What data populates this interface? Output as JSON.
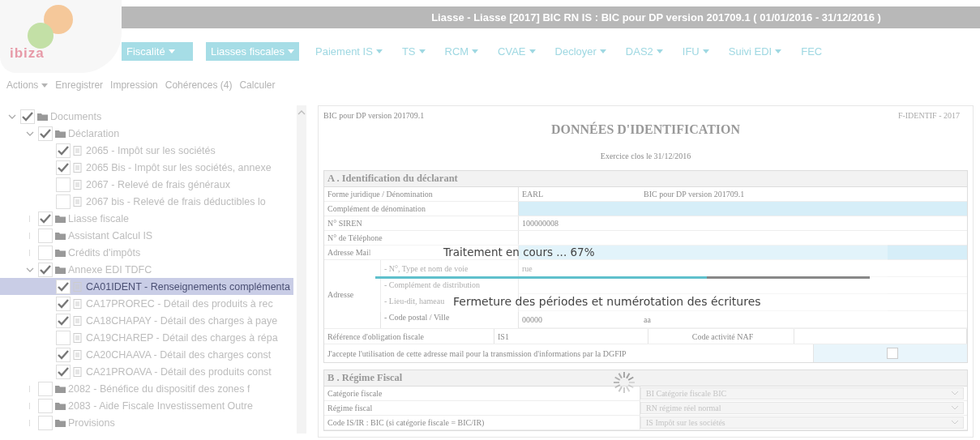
{
  "window": {
    "title": "Liasse - Liasse [2017] BIC RN IS : BIC pour DP version 201709.1 ( 01/01/2016 - 31/12/2016 )"
  },
  "logo": {
    "text": "ibiza"
  },
  "module": {
    "label": "Fiscalité"
  },
  "nav": [
    {
      "label": "Liasses fiscales",
      "selected": true,
      "menu": true
    },
    {
      "label": "Paiement IS",
      "selected": false,
      "menu": true
    },
    {
      "label": "TS",
      "selected": false,
      "menu": true
    },
    {
      "label": "RCM",
      "selected": false,
      "menu": true
    },
    {
      "label": "CVAE",
      "selected": false,
      "menu": true
    },
    {
      "label": "Decloyer",
      "selected": false,
      "menu": true
    },
    {
      "label": "DAS2",
      "selected": false,
      "menu": true
    },
    {
      "label": "IFU",
      "selected": false,
      "menu": true
    },
    {
      "label": "Suivi EDI",
      "selected": false,
      "menu": true
    },
    {
      "label": "FEC",
      "selected": false,
      "menu": false
    }
  ],
  "toolbar": [
    {
      "label": "Actions",
      "menu": true
    },
    {
      "label": "Enregistrer",
      "menu": false
    },
    {
      "label": "Impression",
      "menu": false
    },
    {
      "label": "Cohérences (4)",
      "menu": false
    },
    {
      "label": "Calculer",
      "menu": false
    }
  ],
  "tree": [
    {
      "label": "Documents",
      "kind": "folder",
      "checked": true,
      "expanded": true,
      "selected": false,
      "children": [
        {
          "label": "Déclaration",
          "kind": "folder",
          "checked": true,
          "expanded": true,
          "selected": false,
          "children": [
            {
              "label": "2065 - Impôt sur les sociétés",
              "kind": "doc",
              "checked": true,
              "selected": false
            },
            {
              "label": "2065 Bis - Impôt sur les sociétés, annexe",
              "kind": "doc",
              "checked": true,
              "selected": false
            },
            {
              "label": "2067 - Relevé de frais généraux",
              "kind": "doc",
              "checked": false,
              "selected": false
            },
            {
              "label": "2067 bis - Relevé de frais déductibles lo",
              "kind": "doc",
              "checked": false,
              "selected": false
            }
          ]
        },
        {
          "label": "Liasse fiscale",
          "kind": "folder",
          "checked": true,
          "expanded": false,
          "selected": false
        },
        {
          "label": "Assistant Calcul IS",
          "kind": "folder",
          "checked": false,
          "expanded": false,
          "selected": false
        },
        {
          "label": "Crédits d'impôts",
          "kind": "folder",
          "checked": false,
          "expanded": false,
          "selected": false
        },
        {
          "label": "Annexe EDI TDFC",
          "kind": "folder",
          "checked": true,
          "expanded": true,
          "selected": false,
          "children": [
            {
              "label": "CA01IDENT - Renseignements complémenta",
              "kind": "doc",
              "checked": true,
              "selected": true
            },
            {
              "label": "CA17PROREC - Détail des produits à rec",
              "kind": "doc",
              "checked": true,
              "selected": false
            },
            {
              "label": "CA18CHAPAY - Détail des charges à paye",
              "kind": "doc",
              "checked": true,
              "selected": false
            },
            {
              "label": "CA19CHAREP - Détail des charges à répa",
              "kind": "doc",
              "checked": false,
              "selected": false
            },
            {
              "label": "CA20CHAAVA - Détail des charges const",
              "kind": "doc",
              "checked": true,
              "selected": false
            },
            {
              "label": "CA21PROAVA - Détail des produits const",
              "kind": "doc",
              "checked": true,
              "selected": false
            }
          ]
        },
        {
          "label": "2082 - Bénéfice du dispositif des zones f",
          "kind": "folder",
          "checked": false,
          "expanded": false,
          "selected": false
        },
        {
          "label": "2083 - Aide Fiscale Investissement Outre",
          "kind": "folder",
          "checked": false,
          "expanded": false,
          "selected": false
        },
        {
          "label": "Provisions",
          "kind": "folder",
          "checked": false,
          "expanded": false,
          "selected": false
        }
      ]
    }
  ],
  "form": {
    "doc_ref": "BIC pour DP version 201709.1",
    "title": "DONNÉES D'IDENTIFICATION",
    "form_code": "F-IDENTIF - 2017",
    "subtitle": "Exercice clos le 31/12/2016",
    "sections": [
      {
        "title": "A . Identification du déclarant",
        "rows": [
          {
            "kind": "field",
            "label": "Forme juridique / Dénomination",
            "value": "EARL",
            "value_2": "BIC pour DP version 201709.1",
            "editable": false
          },
          {
            "kind": "field",
            "label": "Complément de dénomination",
            "editable": true
          },
          {
            "kind": "field",
            "label": "N° SIREN",
            "value": "100000008",
            "editable": false
          },
          {
            "kind": "field",
            "label": "N° de Téléphone",
            "editable": false
          },
          {
            "kind": "field",
            "label": "Adresse Mail",
            "editable": true
          },
          {
            "kind": "address",
            "label": "Adresse",
            "lines": [
              {
                "label": "- N°, Type et nom de voie",
                "value": "rue"
              },
              {
                "label": "- Complément de distribution"
              },
              {
                "label": "- Lieu-dit, hameau"
              },
              {
                "label": "- Code postal / Ville",
                "value": "00000",
                "value_2": "aa"
              }
            ]
          },
          {
            "kind": "pair",
            "label": "Référence d'obligation fiscale",
            "value": "IS1",
            "label_2": "Code activité NAF"
          },
          {
            "kind": "consent",
            "label": "J'accepte l'utilisation de cette adresse mail pour la transmission d'informations par la DGFIP",
            "checked": false
          }
        ]
      },
      {
        "title": "B . Régime Fiscal",
        "rows": [
          {
            "kind": "select",
            "label": "Catégorie fiscale",
            "value": "BI Catégorie fiscale BIC"
          },
          {
            "kind": "select",
            "label": "Régime fiscal",
            "value": "RN régime réel normal"
          },
          {
            "kind": "select",
            "label": "Code IS/IR : BIC (si catégorie fiscale = BIC/IR)",
            "value": "IS Impôt sur les sociétés"
          }
        ]
      }
    ]
  },
  "progress": {
    "status": "Traitement en cours ... 67%",
    "level": 0.67,
    "message": "Fermeture des périodes et numérotation des écritures"
  }
}
